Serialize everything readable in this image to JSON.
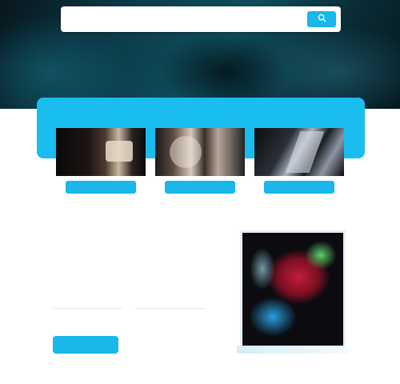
{
  "search": {
    "placeholder": "",
    "button_icon": "search-icon"
  },
  "cards": [
    {
      "button_label": ""
    },
    {
      "button_label": ""
    },
    {
      "button_label": ""
    }
  ],
  "main": {
    "heading": "",
    "subtext": "",
    "meta": [
      "",
      ""
    ],
    "cta_label": ""
  },
  "colors": {
    "accent": "#19b7ea",
    "hero_dark": "#07161c",
    "hero_teal": "#0e4d5c",
    "feature_band": "#19bdf0"
  }
}
